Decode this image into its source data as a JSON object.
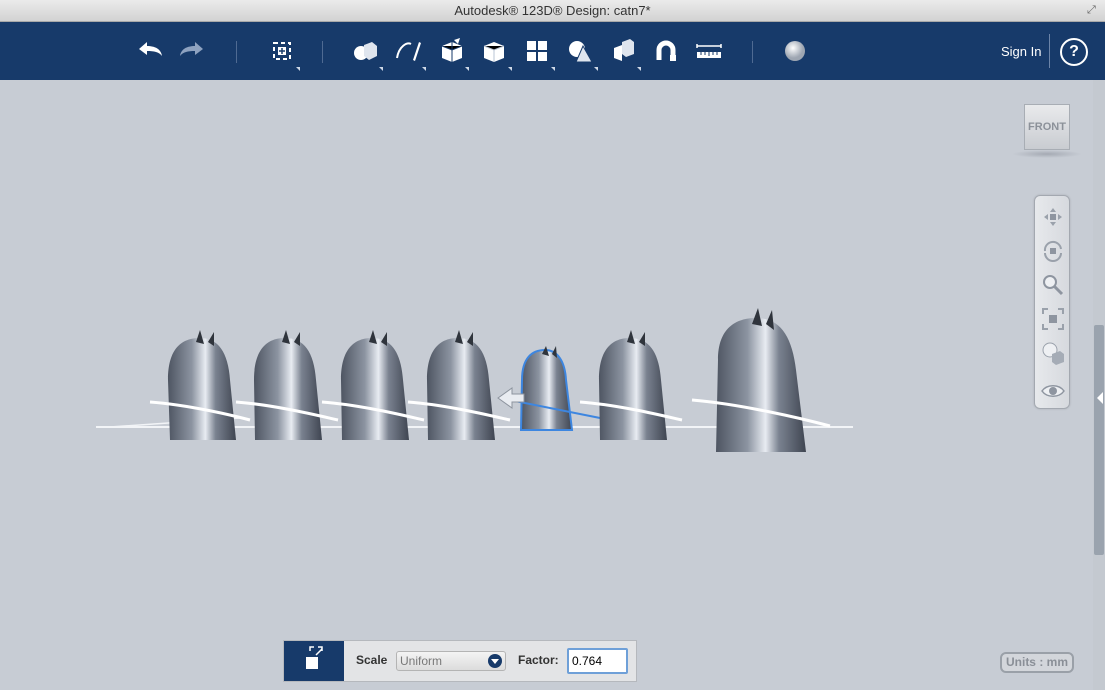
{
  "window": {
    "title": "Autodesk® 123D® Design: catn7*"
  },
  "toolbar": {
    "tools": [
      {
        "id": "undo",
        "icon": "undo-icon"
      },
      {
        "id": "redo",
        "icon": "redo-icon"
      },
      {
        "id": "transform",
        "icon": "transform-icon"
      },
      {
        "id": "primitives",
        "icon": "primitives-icon"
      },
      {
        "id": "sketch",
        "icon": "sketch-icon"
      },
      {
        "id": "construct",
        "icon": "construct-icon"
      },
      {
        "id": "modify",
        "icon": "modify-icon"
      },
      {
        "id": "pattern",
        "icon": "pattern-icon"
      },
      {
        "id": "grouping",
        "icon": "grouping-icon"
      },
      {
        "id": "combine",
        "icon": "combine-icon"
      },
      {
        "id": "snap",
        "icon": "snap-magnet-icon"
      },
      {
        "id": "measure",
        "icon": "measure-icon"
      },
      {
        "id": "material",
        "icon": "material-sphere-icon"
      }
    ],
    "sign_in": "Sign In",
    "help": "?"
  },
  "viewcube": {
    "face": "FRONT"
  },
  "navbar": {
    "tools": [
      "pan-icon",
      "orbit-icon",
      "zoom-icon",
      "fit-icon",
      "view-mode-icon",
      "visibility-eye-icon"
    ]
  },
  "units": {
    "label": "Units : mm"
  },
  "scale_panel": {
    "scale_label": "Scale",
    "scale_mode": "Uniform",
    "factor_label": "Factor:",
    "factor_value": "0.764"
  },
  "colors": {
    "toolbar_bg": "#173a6a",
    "viewport_bg": "#c7ccd4",
    "model_color": "#6f7785",
    "selection_outline": "#3d86e0"
  }
}
